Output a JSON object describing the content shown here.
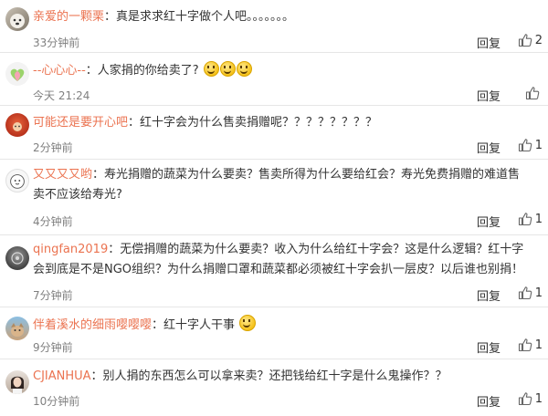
{
  "reply_label": "回复",
  "comments": [
    {
      "username": "亲爱的一颗栗",
      "text": "：真是求求红十字做个人吧。。。。。。。",
      "time": "33分钟前",
      "likes": "2"
    },
    {
      "username": "--心心心--",
      "text": "：人家捐的你给卖了?",
      "time": "今天 21:24",
      "likes": ""
    },
    {
      "username": "可能还是要开心吧",
      "text": "：红十字会为什么售卖捐赠呢？？？？？？？？",
      "time": "2分钟前",
      "likes": "1"
    },
    {
      "username": "又又又又哟",
      "text": "：寿光捐赠的蔬菜为什么要卖？售卖所得为什么要给红会？寿光免费捐赠的难道售卖不应该给寿光?",
      "time": "4分钟前",
      "likes": "1"
    },
    {
      "username": "qingfan2019",
      "text": "：无偿捐赠的蔬菜为什么要卖？收入为什么给红十字会？这是什么逻辑？红十字会到底是不是NGO组织？为什么捐赠口罩和蔬菜都必须被红十字会扒一层皮？以后谁也别捐！",
      "time": "7分钟前",
      "likes": "1"
    },
    {
      "username": "伴着溪水的细雨嘤嘤嘤",
      "text": "：红十字人干事",
      "time": "9分钟前",
      "likes": "1"
    },
    {
      "username": "CJIANHUA",
      "text": "：别人捐的东西怎么可以拿来卖？还把钱给红十字是什么鬼操作？？",
      "time": "10分钟前",
      "likes": "1"
    }
  ],
  "colors": {
    "username": "#eb7350",
    "time": "#808080",
    "divider": "#e6e6e6"
  },
  "icons": {
    "like": "thumbs-up-icon"
  }
}
